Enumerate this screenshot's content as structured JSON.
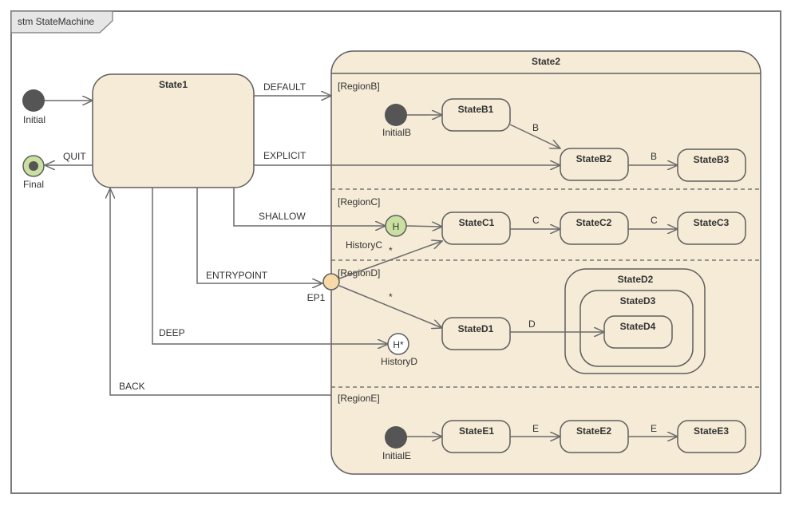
{
  "frame": {
    "title": "stm StateMachine"
  },
  "colors": {
    "state_fill": "#f5ebd7",
    "border": "#5f5f5f",
    "initial_fill": "#555555",
    "final_fill": "#c9e0a0",
    "history_shallow_fill": "#c9e0a0",
    "history_deep_fill": "#ffffff",
    "entry_point_fill": "#f8d9a8"
  },
  "nodes": {
    "initial": "Initial",
    "final": "Final",
    "state1": "State1",
    "state2": "State2",
    "initialB": "InitialB",
    "stateB1": "StateB1",
    "stateB2": "StateB2",
    "stateB3": "StateB3",
    "historyC": "HistoryC",
    "historyC_glyph": "H",
    "stateC1": "StateC1",
    "stateC2": "StateC2",
    "stateC3": "StateC3",
    "ep1": "EP1",
    "historyD": "HistoryD",
    "historyD_glyph": "H*",
    "stateD1": "StateD1",
    "stateD2": "StateD2",
    "stateD3": "StateD3",
    "stateD4": "StateD4",
    "initialE": "InitialE",
    "stateE1": "StateE1",
    "stateE2": "StateE2",
    "stateE3": "StateE3"
  },
  "regions": {
    "b": "[RegionB]",
    "c": "[RegionC]",
    "d": "[RegionD]",
    "e": "[RegionE]"
  },
  "transitions": {
    "default": "DEFAULT",
    "explicit": "EXPLICIT",
    "quit": "QUIT",
    "shallow": "SHALLOW",
    "entrypoint": "ENTRYPOINT",
    "deep": "DEEP",
    "back": "BACK",
    "b1_b2": "B",
    "b2_b3": "B",
    "c1_c2": "C",
    "c2_c3": "C",
    "ep_c1": "*",
    "ep_d1": "*",
    "d1_d4": "D",
    "e1_e2": "E",
    "e2_e3": "E"
  }
}
